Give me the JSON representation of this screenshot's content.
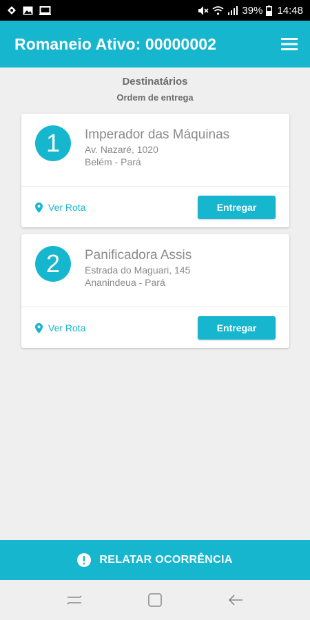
{
  "status_bar": {
    "battery": "39%",
    "time": "14:48",
    "icons": [
      "location-icon",
      "gallery-icon",
      "screen-icon",
      "mute-icon",
      "wifi-icon",
      "signal-icon",
      "battery-icon"
    ]
  },
  "app_bar": {
    "title": "Romaneio Ativo: 00000002",
    "menu_icon": "menu-icon"
  },
  "header": {
    "title": "Destinatários",
    "subtitle": "Ordem de entrega"
  },
  "deliveries": [
    {
      "number": "1",
      "name": "Imperador das Máquinas",
      "address": "Av. Nazaré, 1020",
      "city": "Belém - Pará",
      "route_label": "Ver Rota",
      "deliver_label": "Entregar"
    },
    {
      "number": "2",
      "name": "Panificadora Assis",
      "address": "Estrada do Maguari, 145",
      "city": "Ananindeua - Pará",
      "route_label": "Ver Rota",
      "deliver_label": "Entregar"
    }
  ],
  "footer": {
    "report_label": "RELATAR OCORRÊNCIA"
  },
  "colors": {
    "accent": "#16b6cf",
    "background": "#efefef",
    "text_muted": "#8a8a8a"
  }
}
